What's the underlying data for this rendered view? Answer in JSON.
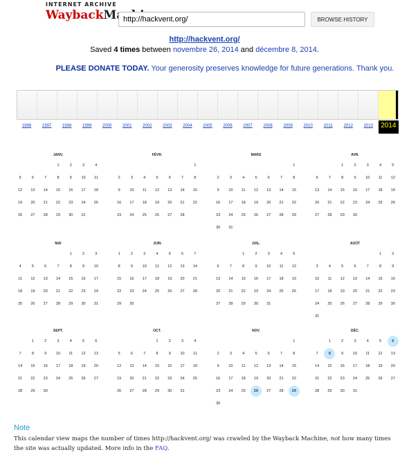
{
  "header": {
    "logo_top": "INTERNET ARCHIVE",
    "logo_wayback": "Wayback",
    "logo_machine": "Machine",
    "url_value": "http://hackvent.org/",
    "browse_button": "BROWSE HISTORY"
  },
  "summary": {
    "site_link": "http://hackvent.org/",
    "saved_prefix": "Saved ",
    "saved_count": "4 times",
    "saved_between": " between ",
    "first_date": "novembre 26, 2014",
    "saved_and": " and ",
    "last_date": "décembre 8, 2014",
    "saved_suffix": "."
  },
  "donate": {
    "strong": "PLEASE DONATE TODAY.",
    "text": " Your generosity preserves knowledge for future generations. Thank you."
  },
  "timeline": {
    "years": [
      "1996",
      "1997",
      "1998",
      "1999",
      "2000",
      "2001",
      "2002",
      "2003",
      "2004",
      "2005",
      "2006",
      "2007",
      "2008",
      "2009",
      "2010",
      "2011",
      "2012",
      "2013",
      "2014"
    ],
    "active_year": "2014"
  },
  "calendar": {
    "months": [
      {
        "name": "JANV.",
        "start": 3,
        "days": 31,
        "snapshots": []
      },
      {
        "name": "FÉVR.",
        "start": 6,
        "days": 28,
        "snapshots": []
      },
      {
        "name": "MARS",
        "start": 6,
        "days": 31,
        "snapshots": []
      },
      {
        "name": "AVR.",
        "start": 2,
        "days": 30,
        "snapshots": []
      },
      {
        "name": "MAI",
        "start": 4,
        "days": 31,
        "snapshots": []
      },
      {
        "name": "JUIN",
        "start": 0,
        "days": 30,
        "snapshots": []
      },
      {
        "name": "JUIL.",
        "start": 2,
        "days": 31,
        "snapshots": []
      },
      {
        "name": "AOÛT",
        "start": 5,
        "days": 31,
        "snapshots": []
      },
      {
        "name": "SEPT.",
        "start": 1,
        "days": 30,
        "snapshots": []
      },
      {
        "name": "OCT.",
        "start": 3,
        "days": 31,
        "snapshots": []
      },
      {
        "name": "NOV.",
        "start": 6,
        "days": 30,
        "snapshots": [
          26,
          29
        ]
      },
      {
        "name": "DÉC.",
        "start": 1,
        "days": 31,
        "snapshots": [
          6,
          8
        ]
      }
    ]
  },
  "note": {
    "title": "Note",
    "text_1": "This calendar view maps the number of times http://hackvent.org/ was crawled by the Wayback Machine, ",
    "text_em": "not",
    "text_2": " how many times the site was actually updated. More info in the ",
    "faq": "FAQ",
    "text_3": "."
  }
}
